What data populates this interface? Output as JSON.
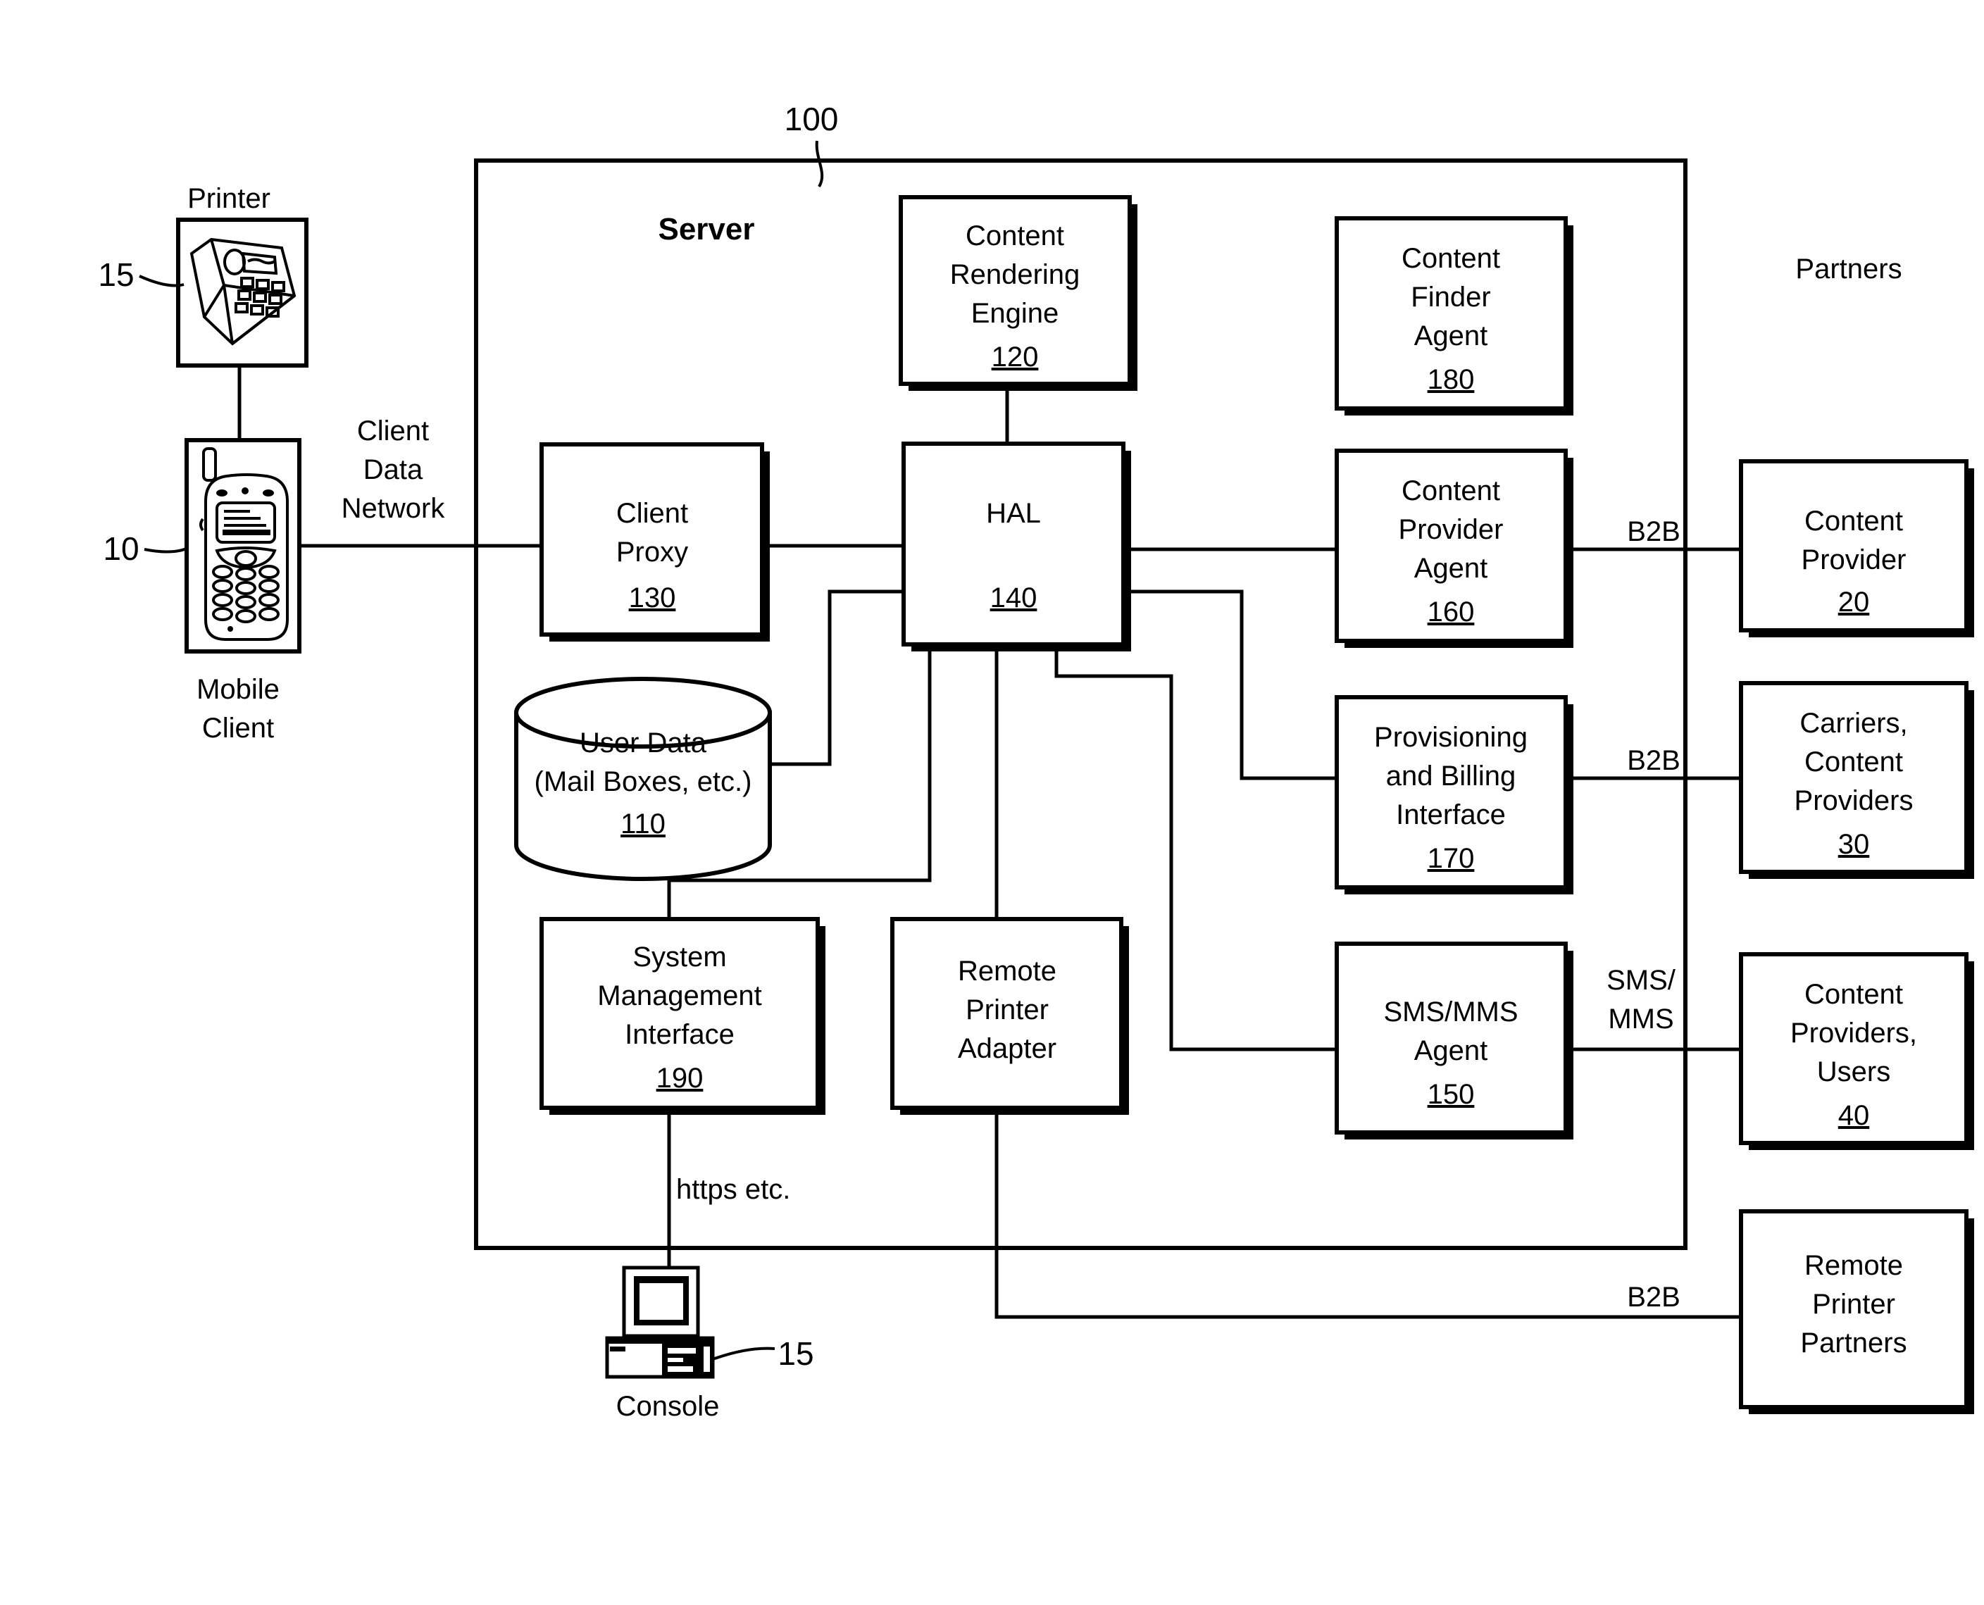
{
  "figure": {
    "system_ref": "100",
    "server_title": "Server",
    "partners_title": "Partners"
  },
  "devices": {
    "printer": {
      "label": "Printer",
      "ref": "15",
      "icon": "printer-fax-icon"
    },
    "mobile": {
      "label_line1": "Mobile",
      "label_line2": "Client",
      "ref": "10",
      "icon": "mobile-phone-icon"
    },
    "console": {
      "label": "Console",
      "ref": "15",
      "icon": "desktop-computer-icon"
    }
  },
  "network": {
    "client_data_network": [
      "Client",
      "Data",
      "Network"
    ],
    "https": "https etc."
  },
  "server_boxes": [
    {
      "id": "content-rendering-engine",
      "lines": [
        "Content",
        "Rendering",
        "Engine"
      ],
      "ref": "120"
    },
    {
      "id": "client-proxy",
      "lines": [
        "Client",
        "Proxy"
      ],
      "ref": "130"
    },
    {
      "id": "hal",
      "lines": [
        "HAL"
      ],
      "ref": "140"
    },
    {
      "id": "user-data",
      "lines": [
        "User Data",
        "(Mail Boxes, etc.)"
      ],
      "ref": "110"
    },
    {
      "id": "system-management-interface",
      "lines": [
        "System",
        "Management",
        "Interface"
      ],
      "ref": "190"
    },
    {
      "id": "remote-printer-adapter",
      "lines": [
        "Remote",
        "Printer",
        "Adapter"
      ],
      "ref": ""
    },
    {
      "id": "content-finder-agent",
      "lines": [
        "Content",
        "Finder",
        "Agent"
      ],
      "ref": "180"
    },
    {
      "id": "content-provider-agent",
      "lines": [
        "Content",
        "Provider",
        "Agent"
      ],
      "ref": "160"
    },
    {
      "id": "provisioning-billing-interface",
      "lines": [
        "Provisioning",
        "and Billing",
        "Interface"
      ],
      "ref": "170"
    },
    {
      "id": "sms-mms-agent",
      "lines": [
        "SMS/MMS",
        "Agent"
      ],
      "ref": "150"
    }
  ],
  "partner_boxes": [
    {
      "id": "content-provider",
      "lines": [
        "Content",
        "Provider"
      ],
      "ref": "20",
      "link": "B2B"
    },
    {
      "id": "carriers-content-providers",
      "lines": [
        "Carriers,",
        "Content",
        "Providers"
      ],
      "ref": "30",
      "link": "B2B"
    },
    {
      "id": "content-providers-users",
      "lines": [
        "Content",
        "Providers,",
        "Users"
      ],
      "ref": "40",
      "link_line1": "SMS/",
      "link_line2": "MMS"
    },
    {
      "id": "remote-printer-partners",
      "lines": [
        "Remote",
        "Printer",
        "Partners"
      ],
      "ref": "",
      "link": "B2B"
    }
  ],
  "colors": {
    "ink": "#000000",
    "paper": "#ffffff"
  }
}
